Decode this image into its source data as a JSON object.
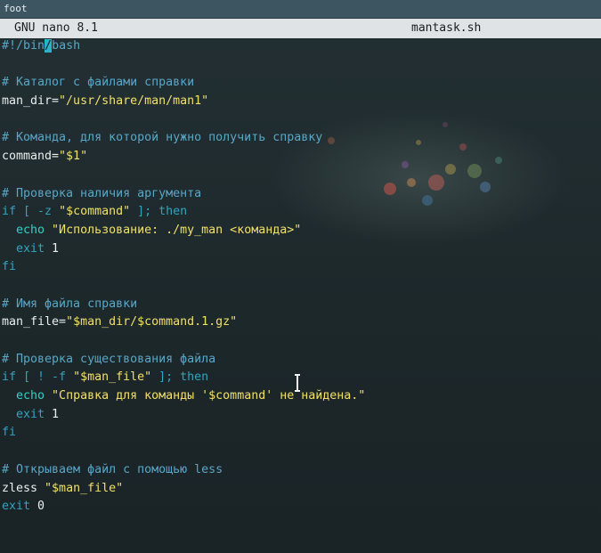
{
  "window": {
    "title": "foot"
  },
  "nano": {
    "version": "GNU nano 8.1",
    "filename": "mantask.sh"
  },
  "code": {
    "l1a": "#!/bin",
    "l1cursor": "/",
    "l1b": "bash",
    "c_catalog": "# Каталог с файлами справки",
    "man_dir_var": "man_dir=",
    "man_dir_val": "\"/usr/share/man/man1\"",
    "c_command": "# Команда, для которой нужно получить справку",
    "command_var": "command=",
    "command_val": "\"$1\"",
    "c_arg": "# Проверка наличия аргумента",
    "if1_a": "if",
    "if1_b": " [ -z ",
    "if1_c": "\"$command\"",
    "if1_d": " ]; ",
    "if1_e": "then",
    "echo1_cmd": "echo",
    "echo1_str": " \"Использование: ./my_man <команда>\"",
    "exit1_kw": "exit",
    "exit1_val": " 1",
    "fi1": "fi",
    "c_filename": "# Имя файла справки",
    "man_file_var": "man_file=",
    "man_file_val": "\"$man_dir/$command.1.gz\"",
    "c_exists": "# Проверка существования файла",
    "if2_a": "if",
    "if2_b": " [ ! -f ",
    "if2_c": "\"$man_file\"",
    "if2_d": " ]; ",
    "if2_e": "then",
    "echo2_cmd": "echo",
    "echo2_str": " \"Справка для команды '$command' не найдена.\"",
    "exit2_kw": "exit",
    "exit2_val": " 1",
    "fi2": "fi",
    "c_open": "# Открываем файл с помощью less",
    "zless_cmd": "zless ",
    "zless_arg": "\"$man_file\"",
    "exit0_kw": "exit",
    "exit0_val": " 0"
  }
}
